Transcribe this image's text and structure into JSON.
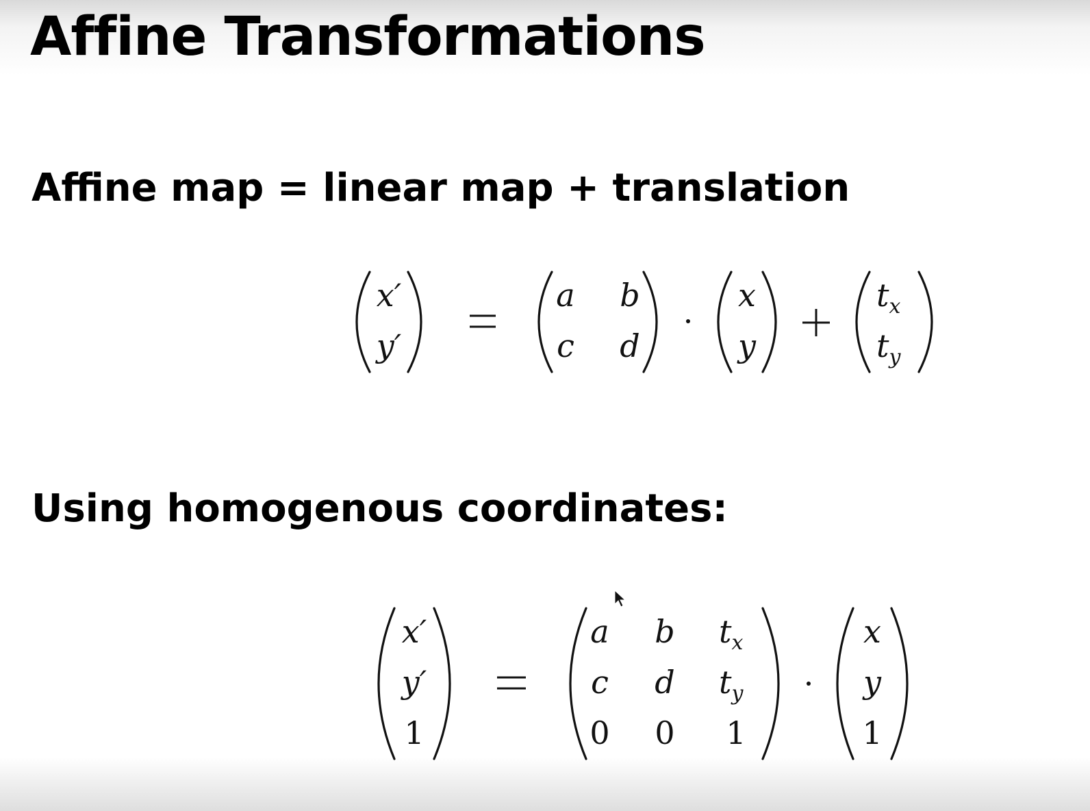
{
  "slide": {
    "title": "Affine Transformations",
    "heading_affine": "Affine map = linear map + translation",
    "heading_homogeneous": "Using homogenous coordinates:"
  },
  "equation_affine": {
    "lhs": [
      "x′",
      "y′"
    ],
    "matrix": [
      [
        "a",
        "b"
      ],
      [
        "c",
        "d"
      ]
    ],
    "vector": [
      "x",
      "y"
    ],
    "translation": [
      {
        "base": "t",
        "sub": "x"
      },
      {
        "base": "t",
        "sub": "y"
      }
    ],
    "equals": "=",
    "dot": "·",
    "plus": "+"
  },
  "equation_homogeneous": {
    "lhs": [
      "x′",
      "y′",
      "1"
    ],
    "matrix": [
      [
        "a",
        "b",
        {
          "base": "t",
          "sub": "x"
        }
      ],
      [
        "c",
        "d",
        {
          "base": "t",
          "sub": "y"
        }
      ],
      [
        "0",
        "0",
        "1"
      ]
    ],
    "vector": [
      "x",
      "y",
      "1"
    ],
    "equals": "=",
    "dot": "·"
  },
  "icons": {
    "cursor": "mouse-pointer-icon"
  }
}
